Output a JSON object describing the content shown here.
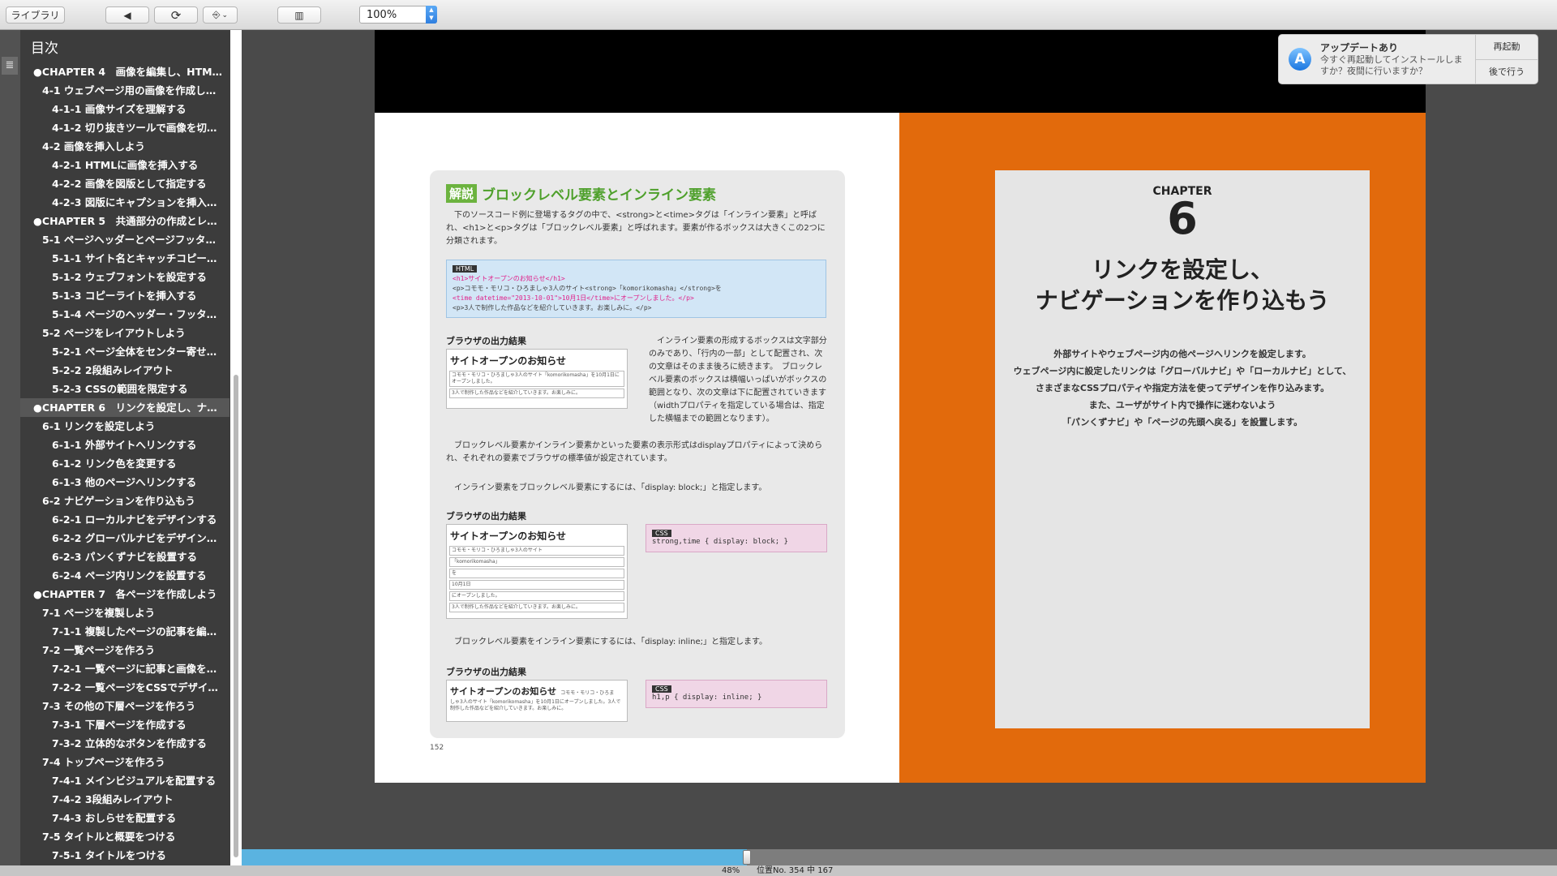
{
  "toolbar": {
    "library_label": "ライブラリ",
    "back_glyph": "◀",
    "sync_glyph": "⟳",
    "goto_glyph": "⎆",
    "dropdown_glyph": "⌄",
    "layout_glyph": "▥",
    "zoom_value": "100%"
  },
  "sidebar": {
    "title": "目次",
    "items": [
      {
        "label": "●CHAPTER 4　画像を編集し、HTMLで…",
        "level": 0
      },
      {
        "label": "4-1 ウェブページ用の画像を作成しよう",
        "level": 1
      },
      {
        "label": "4-1-1 画像サイズを理解する",
        "level": 2
      },
      {
        "label": "4-1-2 切り抜きツールで画像を切り抜く",
        "level": 2
      },
      {
        "label": "4-2 画像を挿入しよう",
        "level": 1
      },
      {
        "label": "4-2-1 HTMLに画像を挿入する",
        "level": 2
      },
      {
        "label": "4-2-2 画像を図版として指定する",
        "level": 2
      },
      {
        "label": "4-2-3 図版にキャプションを挿入する",
        "level": 2
      },
      {
        "label": "●CHAPTER 5　共通部分の作成とレイア…",
        "level": 0
      },
      {
        "label": "5-1 ページヘッダーとページフッターを…",
        "level": 1
      },
      {
        "label": "5-1-1 サイト名とキャッチコピーを挿…",
        "level": 2
      },
      {
        "label": "5-1-2 ウェブフォントを設定する",
        "level": 2
      },
      {
        "label": "5-1-3 コピーライトを挿入する",
        "level": 2
      },
      {
        "label": "5-1-4 ページのヘッダー・フッターと…",
        "level": 2
      },
      {
        "label": "5-2 ページをレイアウトしよう",
        "level": 1
      },
      {
        "label": "5-2-1 ページ全体をセンター寄せにする",
        "level": 2
      },
      {
        "label": "5-2-2 2段組みレイアウト",
        "level": 2
      },
      {
        "label": "5-2-3 CSSの範囲を限定する",
        "level": 2
      },
      {
        "label": "●CHAPTER 6　リンクを設定し、ナビゲ…",
        "level": 0,
        "active": true
      },
      {
        "label": "6-1 リンクを設定しよう",
        "level": 1
      },
      {
        "label": "6-1-1 外部サイトへリンクする",
        "level": 2
      },
      {
        "label": "6-1-2 リンク色を変更する",
        "level": 2
      },
      {
        "label": "6-1-3 他のページへリンクする",
        "level": 2
      },
      {
        "label": "6-2 ナビゲーションを作り込もう",
        "level": 1
      },
      {
        "label": "6-2-1 ローカルナビをデザインする",
        "level": 2
      },
      {
        "label": "6-2-2 グローバルナビをデザインする",
        "level": 2
      },
      {
        "label": "6-2-3 パンくずナビを設置する",
        "level": 2
      },
      {
        "label": "6-2-4 ページ内リンクを設置する",
        "level": 2
      },
      {
        "label": "●CHAPTER 7　各ページを作成しよう",
        "level": 0
      },
      {
        "label": "7-1 ページを複製しよう",
        "level": 1
      },
      {
        "label": "7-1-1 複製したページの記事を編集する",
        "level": 2
      },
      {
        "label": "7-2 一覧ページを作ろう",
        "level": 1
      },
      {
        "label": "7-2-1 一覧ページに記事と画像を挿入…",
        "level": 2
      },
      {
        "label": "7-2-2 一覧ページをCSSでデザインする",
        "level": 2
      },
      {
        "label": "7-3 その他の下層ページを作ろう",
        "level": 1
      },
      {
        "label": "7-3-1 下層ページを作成する",
        "level": 2
      },
      {
        "label": "7-3-2 立体的なボタンを作成する",
        "level": 2
      },
      {
        "label": "7-4 トップページを作ろう",
        "level": 1
      },
      {
        "label": "7-4-1 メインビジュアルを配置する",
        "level": 2
      },
      {
        "label": "7-4-2 3段組みレイアウト",
        "level": 2
      },
      {
        "label": "7-4-3 おしらせを配置する",
        "level": 2
      },
      {
        "label": "7-5 タイトルと概要をつける",
        "level": 1
      },
      {
        "label": "7-5-1 タイトルをつける",
        "level": 2
      }
    ]
  },
  "left_page": {
    "badge": "解説",
    "heading": "ブロックレベル要素とインライン要素",
    "intro": "下のソースコード例に登場するタグの中で、<strong>と<time>タグは「インライン要素」と呼ばれ、<h1>と<p>タグは「ブロックレベル要素」と呼ばれます。要素が作るボックスは大きくこの2つに分類されます。",
    "code_tag": "HTML",
    "code_lines": [
      "<h1>サイトオープンのお知らせ</h1>",
      "<p>コモモ・モリコ・ひろましゃ3人のサイト<strong>「komorikomasha」</strong>を",
      "<time datetime=\"2013-10-01\">10月1日</time>にオープンしました。</p>",
      "<p>3人で制作した作品などを紹介していきます。お楽しみに。</p>"
    ],
    "out_heading": "ブラウザの出力結果",
    "out_title": "サイトオープンのお知らせ",
    "out1_lines": [
      "コモモ・モリコ・ひろましゃ3人のサイト「komorikomasha」を10月1日にオープンしました。",
      "3人で制作した作品などを紹介していきます。お楽しみに。"
    ],
    "side_text": "インライン要素の形成するボックスは文字部分のみであり、「行内の一部」として配置され、次の文章はそのまま後ろに続きます。　ブロックレベル要素のボックスは横幅いっぱいがボックスの範囲となり、次の文章は下に配置されていきます（widthプロパティを指定している場合は、指定した横幅までの範囲となります）。",
    "para2": "ブロックレベル要素かインライン要素かといった要素の表示形式はdisplayプロパティによって決められ、それぞれの要素でブラウザの標準値が設定されています。",
    "para3": "インライン要素をブロックレベル要素にするには、「display: block;」と指定します。",
    "out2_lines": [
      "コモモ・モリコ・ひろましゃ3人のサイト",
      "「komorikomasha」",
      "を",
      "10月1日",
      "にオープンしました。",
      "3人で制作した作品などを紹介していきます。お楽しみに。"
    ],
    "css_tag": "CSS",
    "css1": "strong,time { display: block; }",
    "para4": "ブロックレベル要素をインライン要素にするには、「display: inline;」と指定します。",
    "out3_inline": "コモモ・モリコ・ひろま",
    "out3_body": "しゃ3人のサイト「komorikomasha」を10月1日にオープンしました。3人で制作した作品などを紹介していきます。お楽しみに。",
    "css2": "h1,p { display: inline; }",
    "page_number": "152"
  },
  "right_page": {
    "chapter_label": "CHAPTER",
    "chapter_number": "6",
    "title_line1": "リンクを設定し、",
    "title_line2": "ナビゲーションを作り込もう",
    "desc_lines": [
      "外部サイトやウェブページ内の他ページへリンクを設定します。",
      "ウェブページ内に設定したリンクは「グローバルナビ」や「ローカルナビ」として、",
      "さまざまなCSSプロパティや指定方法を使ってデザインを作り込みます。",
      "また、ユーザがサイト内で操作に迷わないよう",
      "「パンくずナビ」や「ページの先頭へ戻る」を設置します。"
    ],
    "bg_color": "#e26a0c"
  },
  "notification": {
    "icon_glyph": "A",
    "title": "アップデートあり",
    "message": "今すぐ再起動してインストールしますか？夜間に行いますか？",
    "restart_label": "再起動",
    "later_label": "後で行う"
  },
  "progress": {
    "fraction": 0.384
  },
  "status": {
    "percent": "48%",
    "location": "位置No. 354 中 167"
  }
}
